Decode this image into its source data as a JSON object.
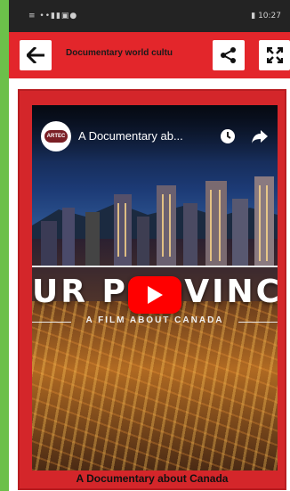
{
  "status_bar": {
    "left_icons": "≡ ••▮▮▣●",
    "right": "▮ 10:27"
  },
  "app_bar": {
    "title": "Documentary world cultu",
    "back_icon": "arrow-left-icon",
    "share_icon": "share-icon",
    "expand_icon": "fullscreen-icon",
    "accent": "#e3262b"
  },
  "video": {
    "title": "A Documentary ab...",
    "channel_avatar_text": "ARTEC",
    "headline": "UR PROVINCE",
    "subheadline": "A FILM ABOUT CANADA",
    "play_icon": "play-icon",
    "clock_icon": "clock-icon",
    "share_icon": "share-arrow-icon"
  },
  "card": {
    "caption": "A Documentary about Canada",
    "background": "#d4262a"
  }
}
